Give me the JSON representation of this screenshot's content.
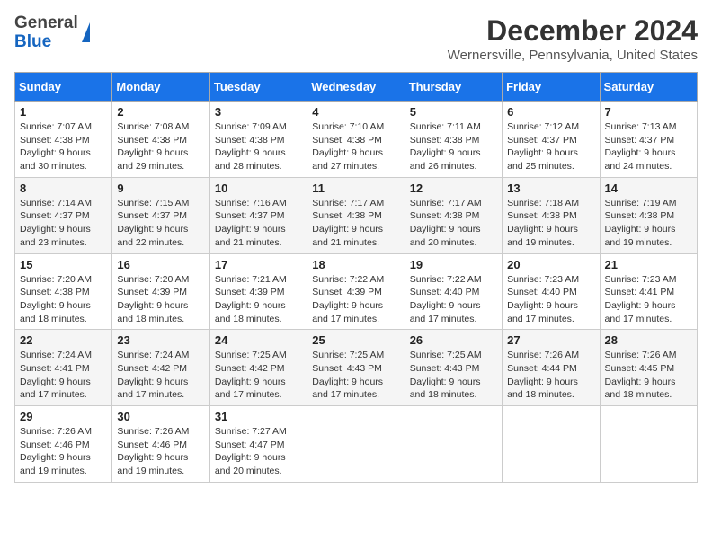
{
  "header": {
    "logo_general": "General",
    "logo_blue": "Blue",
    "month_title": "December 2024",
    "location": "Wernersville, Pennsylvania, United States"
  },
  "days_of_week": [
    "Sunday",
    "Monday",
    "Tuesday",
    "Wednesday",
    "Thursday",
    "Friday",
    "Saturday"
  ],
  "weeks": [
    [
      {
        "day": "1",
        "sunrise": "Sunrise: 7:07 AM",
        "sunset": "Sunset: 4:38 PM",
        "daylight": "Daylight: 9 hours and 30 minutes."
      },
      {
        "day": "2",
        "sunrise": "Sunrise: 7:08 AM",
        "sunset": "Sunset: 4:38 PM",
        "daylight": "Daylight: 9 hours and 29 minutes."
      },
      {
        "day": "3",
        "sunrise": "Sunrise: 7:09 AM",
        "sunset": "Sunset: 4:38 PM",
        "daylight": "Daylight: 9 hours and 28 minutes."
      },
      {
        "day": "4",
        "sunrise": "Sunrise: 7:10 AM",
        "sunset": "Sunset: 4:38 PM",
        "daylight": "Daylight: 9 hours and 27 minutes."
      },
      {
        "day": "5",
        "sunrise": "Sunrise: 7:11 AM",
        "sunset": "Sunset: 4:38 PM",
        "daylight": "Daylight: 9 hours and 26 minutes."
      },
      {
        "day": "6",
        "sunrise": "Sunrise: 7:12 AM",
        "sunset": "Sunset: 4:37 PM",
        "daylight": "Daylight: 9 hours and 25 minutes."
      },
      {
        "day": "7",
        "sunrise": "Sunrise: 7:13 AM",
        "sunset": "Sunset: 4:37 PM",
        "daylight": "Daylight: 9 hours and 24 minutes."
      }
    ],
    [
      {
        "day": "8",
        "sunrise": "Sunrise: 7:14 AM",
        "sunset": "Sunset: 4:37 PM",
        "daylight": "Daylight: 9 hours and 23 minutes."
      },
      {
        "day": "9",
        "sunrise": "Sunrise: 7:15 AM",
        "sunset": "Sunset: 4:37 PM",
        "daylight": "Daylight: 9 hours and 22 minutes."
      },
      {
        "day": "10",
        "sunrise": "Sunrise: 7:16 AM",
        "sunset": "Sunset: 4:37 PM",
        "daylight": "Daylight: 9 hours and 21 minutes."
      },
      {
        "day": "11",
        "sunrise": "Sunrise: 7:17 AM",
        "sunset": "Sunset: 4:38 PM",
        "daylight": "Daylight: 9 hours and 21 minutes."
      },
      {
        "day": "12",
        "sunrise": "Sunrise: 7:17 AM",
        "sunset": "Sunset: 4:38 PM",
        "daylight": "Daylight: 9 hours and 20 minutes."
      },
      {
        "day": "13",
        "sunrise": "Sunrise: 7:18 AM",
        "sunset": "Sunset: 4:38 PM",
        "daylight": "Daylight: 9 hours and 19 minutes."
      },
      {
        "day": "14",
        "sunrise": "Sunrise: 7:19 AM",
        "sunset": "Sunset: 4:38 PM",
        "daylight": "Daylight: 9 hours and 19 minutes."
      }
    ],
    [
      {
        "day": "15",
        "sunrise": "Sunrise: 7:20 AM",
        "sunset": "Sunset: 4:38 PM",
        "daylight": "Daylight: 9 hours and 18 minutes."
      },
      {
        "day": "16",
        "sunrise": "Sunrise: 7:20 AM",
        "sunset": "Sunset: 4:39 PM",
        "daylight": "Daylight: 9 hours and 18 minutes."
      },
      {
        "day": "17",
        "sunrise": "Sunrise: 7:21 AM",
        "sunset": "Sunset: 4:39 PM",
        "daylight": "Daylight: 9 hours and 18 minutes."
      },
      {
        "day": "18",
        "sunrise": "Sunrise: 7:22 AM",
        "sunset": "Sunset: 4:39 PM",
        "daylight": "Daylight: 9 hours and 17 minutes."
      },
      {
        "day": "19",
        "sunrise": "Sunrise: 7:22 AM",
        "sunset": "Sunset: 4:40 PM",
        "daylight": "Daylight: 9 hours and 17 minutes."
      },
      {
        "day": "20",
        "sunrise": "Sunrise: 7:23 AM",
        "sunset": "Sunset: 4:40 PM",
        "daylight": "Daylight: 9 hours and 17 minutes."
      },
      {
        "day": "21",
        "sunrise": "Sunrise: 7:23 AM",
        "sunset": "Sunset: 4:41 PM",
        "daylight": "Daylight: 9 hours and 17 minutes."
      }
    ],
    [
      {
        "day": "22",
        "sunrise": "Sunrise: 7:24 AM",
        "sunset": "Sunset: 4:41 PM",
        "daylight": "Daylight: 9 hours and 17 minutes."
      },
      {
        "day": "23",
        "sunrise": "Sunrise: 7:24 AM",
        "sunset": "Sunset: 4:42 PM",
        "daylight": "Daylight: 9 hours and 17 minutes."
      },
      {
        "day": "24",
        "sunrise": "Sunrise: 7:25 AM",
        "sunset": "Sunset: 4:42 PM",
        "daylight": "Daylight: 9 hours and 17 minutes."
      },
      {
        "day": "25",
        "sunrise": "Sunrise: 7:25 AM",
        "sunset": "Sunset: 4:43 PM",
        "daylight": "Daylight: 9 hours and 17 minutes."
      },
      {
        "day": "26",
        "sunrise": "Sunrise: 7:25 AM",
        "sunset": "Sunset: 4:43 PM",
        "daylight": "Daylight: 9 hours and 18 minutes."
      },
      {
        "day": "27",
        "sunrise": "Sunrise: 7:26 AM",
        "sunset": "Sunset: 4:44 PM",
        "daylight": "Daylight: 9 hours and 18 minutes."
      },
      {
        "day": "28",
        "sunrise": "Sunrise: 7:26 AM",
        "sunset": "Sunset: 4:45 PM",
        "daylight": "Daylight: 9 hours and 18 minutes."
      }
    ],
    [
      {
        "day": "29",
        "sunrise": "Sunrise: 7:26 AM",
        "sunset": "Sunset: 4:46 PM",
        "daylight": "Daylight: 9 hours and 19 minutes."
      },
      {
        "day": "30",
        "sunrise": "Sunrise: 7:26 AM",
        "sunset": "Sunset: 4:46 PM",
        "daylight": "Daylight: 9 hours and 19 minutes."
      },
      {
        "day": "31",
        "sunrise": "Sunrise: 7:27 AM",
        "sunset": "Sunset: 4:47 PM",
        "daylight": "Daylight: 9 hours and 20 minutes."
      },
      null,
      null,
      null,
      null
    ]
  ]
}
